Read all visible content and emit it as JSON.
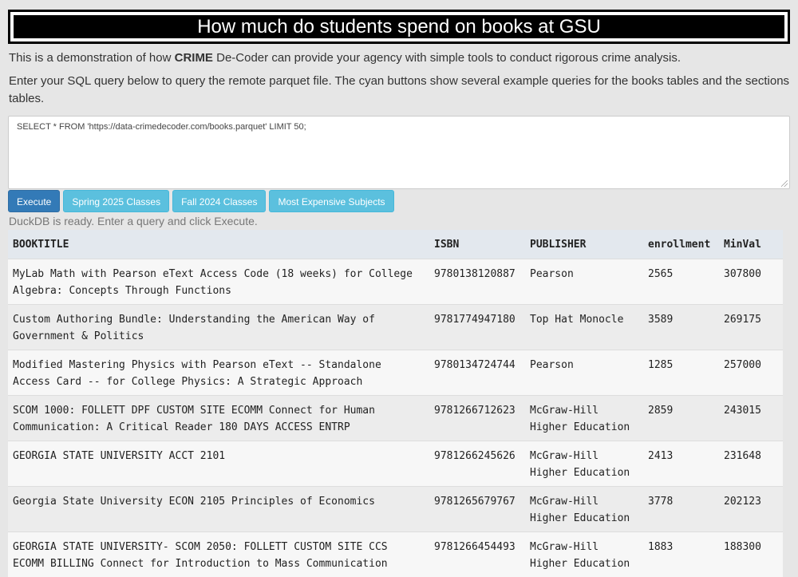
{
  "header": {
    "title": "How much do students spend on books at GSU"
  },
  "intro": {
    "before": "This is a demonstration of how ",
    "bold": "CRIME",
    "after": " De-Coder can provide your agency with simple tools to conduct rigorous crime analysis."
  },
  "instructions": "Enter your SQL query below to query the remote parquet file. The cyan buttons show several example queries for the books tables and the sections tables.",
  "query": {
    "value": "SELECT * FROM 'https://data-crimedecoder.com/books.parquet' LIMIT 50;"
  },
  "buttons": {
    "execute": "Execute",
    "spring": "Spring 2025 Classes",
    "fall": "Fall 2024 Classes",
    "expensive": "Most Expensive Subjects"
  },
  "status": "DuckDB is ready. Enter a query and click Execute.",
  "table": {
    "headers": [
      "BOOKTITLE",
      "ISBN",
      "PUBLISHER",
      "enrollment",
      "MinVal"
    ],
    "rows": [
      {
        "title": "MyLab Math with Pearson eText Access Code (18 weeks) for College Algebra: Concepts Through Functions",
        "isbn": "9780138120887",
        "publisher": "Pearson",
        "enrollment": "2565",
        "minval": "307800"
      },
      {
        "title": "Custom Authoring Bundle: Understanding the American Way of Government & Politics",
        "isbn": "9781774947180",
        "publisher": "Top Hat Monocle",
        "enrollment": "3589",
        "minval": "269175"
      },
      {
        "title": "Modified Mastering Physics with Pearson eText -- Standalone Access Card -- for College Physics: A Strategic Approach",
        "isbn": "9780134724744",
        "publisher": "Pearson",
        "enrollment": "1285",
        "minval": "257000"
      },
      {
        "title": "SCOM 1000: FOLLETT DPF CUSTOM SITE ECOMM Connect for Human Communication: A Critical Reader 180 DAYS ACCESS ENTRP",
        "isbn": "9781266712623",
        "publisher": "McGraw-Hill Higher Education",
        "enrollment": "2859",
        "minval": "243015"
      },
      {
        "title": "GEORGIA STATE UNIVERSITY ACCT 2101",
        "isbn": "9781266245626",
        "publisher": "McGraw-Hill Higher Education",
        "enrollment": "2413",
        "minval": "231648"
      },
      {
        "title": "Georgia State University ECON 2105 Principles of Economics",
        "isbn": "9781265679767",
        "publisher": "McGraw-Hill Higher Education",
        "enrollment": "3778",
        "minval": "202123"
      },
      {
        "title": "GEORGIA STATE UNIVERSITY- SCOM 2050: FOLLETT CUSTOM SITE CCS ECOMM BILLING Connect for Introduction to Mass Communication",
        "isbn": "9781266454493",
        "publisher": "McGraw-Hill Higher Education",
        "enrollment": "1883",
        "minval": "188300"
      }
    ]
  }
}
